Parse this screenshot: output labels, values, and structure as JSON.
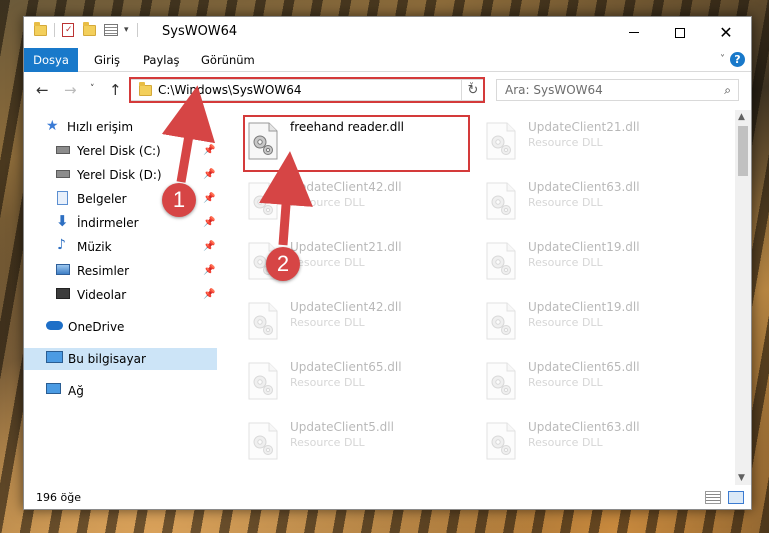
{
  "window": {
    "title": "SysWOW64"
  },
  "ribbon": {
    "tabs": [
      "Dosya",
      "Giriş",
      "Paylaş",
      "Görünüm"
    ],
    "help_glyph": "?"
  },
  "nav": {
    "address": "C:\\Windows\\SysWOW64",
    "search_placeholder": "Ara: SysWOW64"
  },
  "sidebar": {
    "items": [
      {
        "label": "Hızlı erişim",
        "icon": "star-icon"
      },
      {
        "label": "Yerel Disk (C:)",
        "icon": "drive-icon"
      },
      {
        "label": "Yerel Disk (D:)",
        "icon": "drive-icon"
      },
      {
        "label": "Belgeler",
        "icon": "documents-icon"
      },
      {
        "label": "İndirmeler",
        "icon": "download-icon"
      },
      {
        "label": "Müzik",
        "icon": "music-icon"
      },
      {
        "label": "Resimler",
        "icon": "pictures-icon"
      },
      {
        "label": "Videolar",
        "icon": "videos-icon"
      },
      {
        "label": "OneDrive",
        "icon": "cloud-icon"
      },
      {
        "label": "Bu bilgisayar",
        "icon": "computer-icon"
      },
      {
        "label": "Ağ",
        "icon": "network-icon"
      }
    ]
  },
  "files": [
    {
      "name": "freehand reader.dll",
      "type": ""
    },
    {
      "name": "UpdateClient21.dll",
      "type": "Resource DLL"
    },
    {
      "name": "UpdateClient42.dll",
      "type": "Resource DLL"
    },
    {
      "name": "UpdateClient63.dll",
      "type": "Resource DLL"
    },
    {
      "name": "UpdateClient21.dll",
      "type": "Resource DLL"
    },
    {
      "name": "UpdateClient19.dll",
      "type": "Resource DLL"
    },
    {
      "name": "UpdateClient42.dll",
      "type": "Resource DLL"
    },
    {
      "name": "UpdateClient19.dll",
      "type": "Resource DLL"
    },
    {
      "name": "UpdateClient65.dll",
      "type": "Resource DLL"
    },
    {
      "name": "UpdateClient65.dll",
      "type": "Resource DLL"
    },
    {
      "name": "UpdateClient5.dll",
      "type": "Resource DLL"
    },
    {
      "name": "UpdateClient63.dll",
      "type": "Resource DLL"
    }
  ],
  "status": {
    "count": "196 öğe"
  },
  "callouts": [
    "1",
    "2"
  ],
  "colors": {
    "accent": "#1979ca",
    "highlight": "#d43a3a",
    "selected": "#cce4f7"
  }
}
